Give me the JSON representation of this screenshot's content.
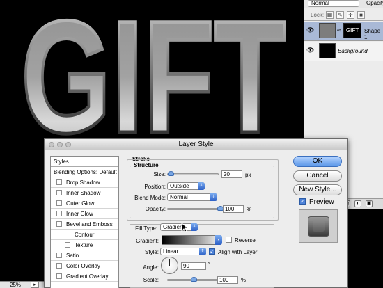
{
  "canvas": {
    "artwork_text": "GIFT",
    "zoom": "25%"
  },
  "layers_panel": {
    "blend_mode": "Normal",
    "opacity_label": "Opacity",
    "lock_label": "Lock:",
    "layers": [
      {
        "name": "Shape 1",
        "mask_text": "GIFT",
        "selected": true
      },
      {
        "name": "Background",
        "selected": false
      }
    ]
  },
  "dialog": {
    "title": "Layer Style",
    "styles_list": [
      {
        "label": "Styles",
        "checkbox": false,
        "indent": 0
      },
      {
        "label": "Blending Options: Default",
        "checkbox": false,
        "indent": 0
      },
      {
        "label": "Drop Shadow",
        "checkbox": true,
        "checked": false,
        "indent": 0
      },
      {
        "label": "Inner Shadow",
        "checkbox": true,
        "checked": false,
        "indent": 0
      },
      {
        "label": "Outer Glow",
        "checkbox": true,
        "checked": false,
        "indent": 0
      },
      {
        "label": "Inner Glow",
        "checkbox": true,
        "checked": false,
        "indent": 0
      },
      {
        "label": "Bevel and Emboss",
        "checkbox": true,
        "checked": false,
        "indent": 0
      },
      {
        "label": "Contour",
        "checkbox": true,
        "checked": false,
        "indent": 1
      },
      {
        "label": "Texture",
        "checkbox": true,
        "checked": false,
        "indent": 1
      },
      {
        "label": "Satin",
        "checkbox": true,
        "checked": false,
        "indent": 0
      },
      {
        "label": "Color Overlay",
        "checkbox": true,
        "checked": false,
        "indent": 0
      },
      {
        "label": "Gradient Overlay",
        "checkbox": true,
        "checked": false,
        "indent": 0
      }
    ],
    "stroke": {
      "title": "Stroke",
      "structure_title": "Structure",
      "size_label": "Size:",
      "size_value": "20",
      "size_unit": "px",
      "size_fraction": 0.08,
      "position_label": "Position:",
      "position_value": "Outside",
      "blend_mode_label": "Blend Mode:",
      "blend_mode_value": "Normal",
      "opacity_label": "Opacity:",
      "opacity_value": "100",
      "opacity_unit": "%",
      "opacity_fraction": 1.0,
      "fill_type_label": "Fill Type:",
      "fill_type_value": "Gradient",
      "gradient_label": "Gradient:",
      "reverse_label": "Reverse",
      "reverse_checked": false,
      "style_label": "Style:",
      "style_value": "Linear",
      "align_label": "Align with Layer",
      "align_checked": true,
      "angle_label": "Angle:",
      "angle_value": "90",
      "angle_unit": "°",
      "scale_label": "Scale:",
      "scale_value": "100",
      "scale_unit": "%",
      "scale_fraction": 0.5
    },
    "buttons": {
      "ok": "OK",
      "cancel": "Cancel",
      "new_style": "New Style...",
      "preview_label": "Preview",
      "preview_checked": true
    }
  },
  "colors": {
    "canvas_bg": "#000000",
    "panel_bg": "#ececec",
    "selected_layer": "#a9b9d6",
    "accent": "#4d82d8"
  }
}
